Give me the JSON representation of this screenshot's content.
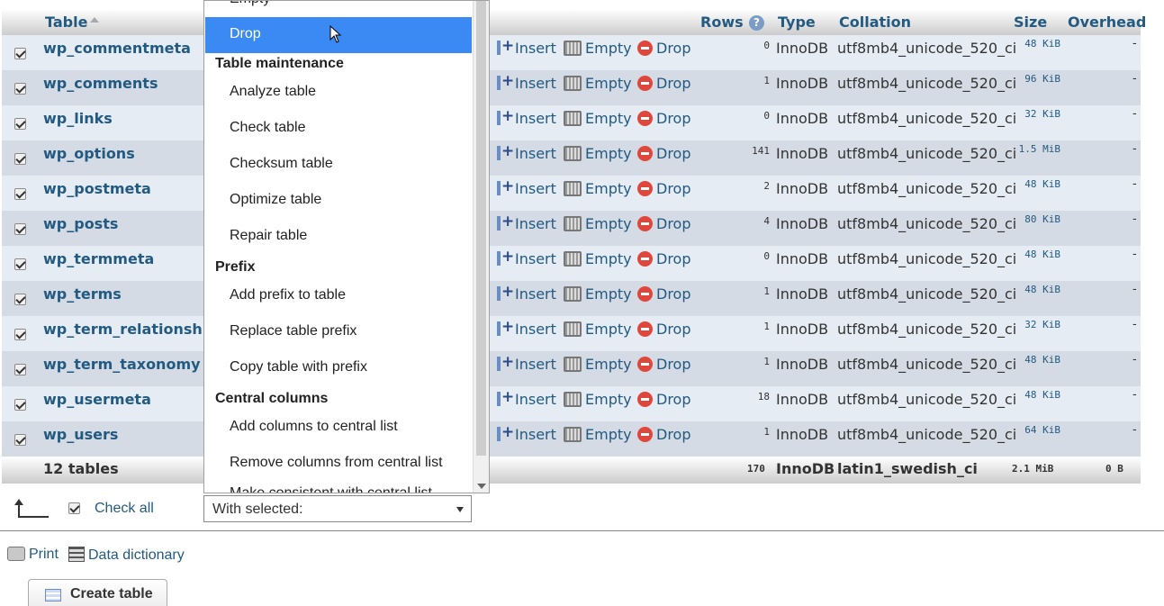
{
  "header": {
    "table": "Table",
    "rows": "Rows",
    "type": "Type",
    "collation": "Collation",
    "size": "Size",
    "overhead": "Overhead"
  },
  "actions": {
    "insert": "Insert",
    "empty": "Empty",
    "drop": "Drop"
  },
  "rows": [
    {
      "name": "wp_commentmeta",
      "rows": "0",
      "type": "InnoDB",
      "collation": "utf8mb4_unicode_520_ci",
      "size": "48 KiB",
      "overhead": "-"
    },
    {
      "name": "wp_comments",
      "rows": "1",
      "type": "InnoDB",
      "collation": "utf8mb4_unicode_520_ci",
      "size": "96 KiB",
      "overhead": "-"
    },
    {
      "name": "wp_links",
      "rows": "0",
      "type": "InnoDB",
      "collation": "utf8mb4_unicode_520_ci",
      "size": "32 KiB",
      "overhead": "-"
    },
    {
      "name": "wp_options",
      "rows": "141",
      "type": "InnoDB",
      "collation": "utf8mb4_unicode_520_ci",
      "size": "1.5 MiB",
      "overhead": "-"
    },
    {
      "name": "wp_postmeta",
      "rows": "2",
      "type": "InnoDB",
      "collation": "utf8mb4_unicode_520_ci",
      "size": "48 KiB",
      "overhead": "-"
    },
    {
      "name": "wp_posts",
      "rows": "4",
      "type": "InnoDB",
      "collation": "utf8mb4_unicode_520_ci",
      "size": "80 KiB",
      "overhead": "-"
    },
    {
      "name": "wp_termmeta",
      "rows": "0",
      "type": "InnoDB",
      "collation": "utf8mb4_unicode_520_ci",
      "size": "48 KiB",
      "overhead": "-"
    },
    {
      "name": "wp_terms",
      "rows": "1",
      "type": "InnoDB",
      "collation": "utf8mb4_unicode_520_ci",
      "size": "48 KiB",
      "overhead": "-"
    },
    {
      "name": "wp_term_relationships",
      "rows": "1",
      "type": "InnoDB",
      "collation": "utf8mb4_unicode_520_ci",
      "size": "32 KiB",
      "overhead": "-"
    },
    {
      "name": "wp_term_taxonomy",
      "rows": "1",
      "type": "InnoDB",
      "collation": "utf8mb4_unicode_520_ci",
      "size": "48 KiB",
      "overhead": "-"
    },
    {
      "name": "wp_usermeta",
      "rows": "18",
      "type": "InnoDB",
      "collation": "utf8mb4_unicode_520_ci",
      "size": "48 KiB",
      "overhead": "-"
    },
    {
      "name": "wp_users",
      "rows": "1",
      "type": "InnoDB",
      "collation": "utf8mb4_unicode_520_ci",
      "size": "64 KiB",
      "overhead": "-"
    }
  ],
  "footer": {
    "count": "12 tables",
    "rows": "170",
    "type": "InnoDB",
    "collation": "latin1_swedish_ci",
    "size": "2.1 MiB",
    "overhead": "0 B"
  },
  "dropdown": {
    "partial_top": "Empty",
    "selected": "Drop",
    "groups": [
      {
        "label": "Table maintenance",
        "items": [
          "Analyze table",
          "Check table",
          "Checksum table",
          "Optimize table",
          "Repair table"
        ]
      },
      {
        "label": "Prefix",
        "items": [
          "Add prefix to table",
          "Replace table prefix",
          "Copy table with prefix"
        ]
      },
      {
        "label": "Central columns",
        "items": [
          "Add columns to central list",
          "Remove columns from central list"
        ]
      }
    ],
    "partial_bottom": "Make consistent with central list"
  },
  "bottom": {
    "check_all": "Check all",
    "with_selected": "With selected:",
    "print": "Print",
    "data_dictionary": "Data dictionary",
    "create_table": "Create table"
  }
}
